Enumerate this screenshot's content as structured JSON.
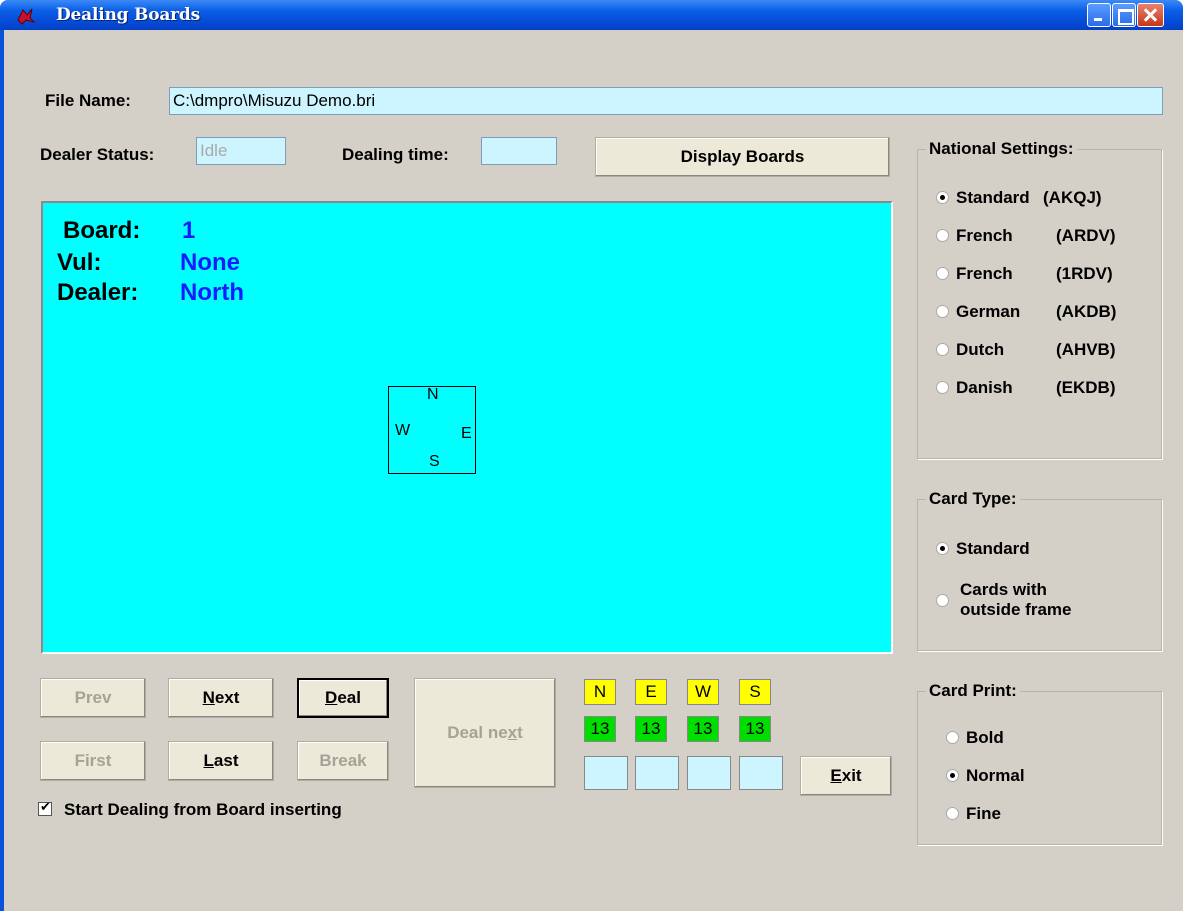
{
  "window": {
    "title": "Dealing Boards"
  },
  "file": {
    "label": "File Name:",
    "value": "C:\\dmpro\\Misuzu Demo.bri"
  },
  "status": {
    "dealer_status_label": "Dealer Status:",
    "dealer_status_value": "Idle",
    "dealing_time_label": "Dealing time:",
    "dealing_time_value": ""
  },
  "buttons": {
    "display_boards": "Display Boards",
    "prev": "Prev",
    "next_first": "N",
    "next_rest": "ext",
    "deal_first": "D",
    "deal_rest": "eal",
    "deal_next_a": "Deal ne",
    "deal_next_u": "x",
    "deal_next_b": "t",
    "first": "First",
    "last_first": "L",
    "last_rest": "ast",
    "break": "Break",
    "exit_first": "E",
    "exit_rest": "xit"
  },
  "board": {
    "board_label": "Board:",
    "board_value": "1",
    "vul_label": "Vul:",
    "vul_value": "None",
    "dealer_label": "Dealer:",
    "dealer_value": "North",
    "compass": {
      "n": "N",
      "e": "E",
      "s": "S",
      "w": "W"
    }
  },
  "national_settings": {
    "title": "National Settings:",
    "options": [
      {
        "name": "Standard",
        "code": "(AKQJ)",
        "selected": true
      },
      {
        "name": "French",
        "code": "(ARDV)",
        "selected": false
      },
      {
        "name": "French",
        "code": "(1RDV)",
        "selected": false
      },
      {
        "name": "German",
        "code": "(AKDB)",
        "selected": false
      },
      {
        "name": "Dutch",
        "code": "(AHVB)",
        "selected": false
      },
      {
        "name": "Danish",
        "code": "(EKDB)",
        "selected": false
      }
    ]
  },
  "card_type": {
    "title": "Card Type:",
    "options": [
      {
        "label": "Standard",
        "selected": true
      },
      {
        "label_line1": "Cards with",
        "label_line2": "outside frame",
        "selected": false
      }
    ]
  },
  "card_print": {
    "title": "Card Print:",
    "options": [
      {
        "label": "Bold",
        "selected": false
      },
      {
        "label": "Normal",
        "selected": true
      },
      {
        "label": "Fine",
        "selected": false
      }
    ]
  },
  "seats": [
    {
      "name": "N",
      "count": "13"
    },
    {
      "name": "E",
      "count": "13"
    },
    {
      "name": "W",
      "count": "13"
    },
    {
      "name": "S",
      "count": "13"
    }
  ],
  "options": {
    "start_dealing_label": "Start Dealing from Board inserting",
    "start_dealing_checked": true
  },
  "colors": {
    "board_background": "#00ffff",
    "board_value_text": "#1a1aff",
    "seat_name_bg": "#ffff00",
    "seat_count_bg": "#00dd00",
    "field_bg": "#ccf5ff"
  }
}
